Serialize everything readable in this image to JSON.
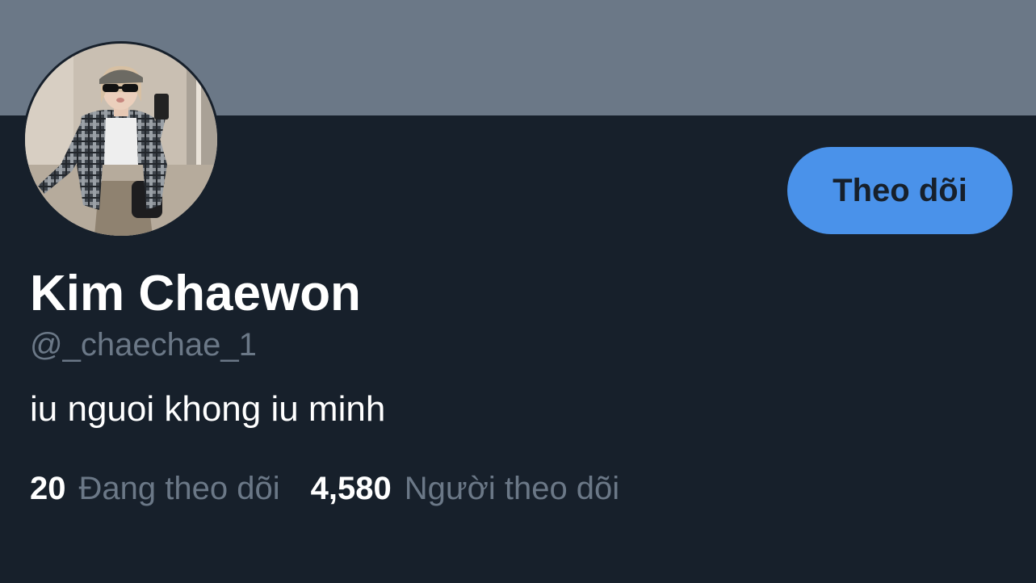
{
  "profile": {
    "display_name": "Kim Chaewon",
    "handle": "@_chaechae_1",
    "bio": "iu nguoi khong iu minh",
    "follow_button_label": "Theo dõi",
    "avatar_alt": "Kim Chaewon profile photo"
  },
  "stats": {
    "following_count": "20",
    "following_label": "Đang theo dõi",
    "followers_count": "4,580",
    "followers_label": "Người theo dõi"
  },
  "colors": {
    "background": "#17202b",
    "banner": "#6b7887",
    "accent": "#4a92ea",
    "secondary_text": "#6b7887",
    "primary_text": "#ffffff"
  }
}
